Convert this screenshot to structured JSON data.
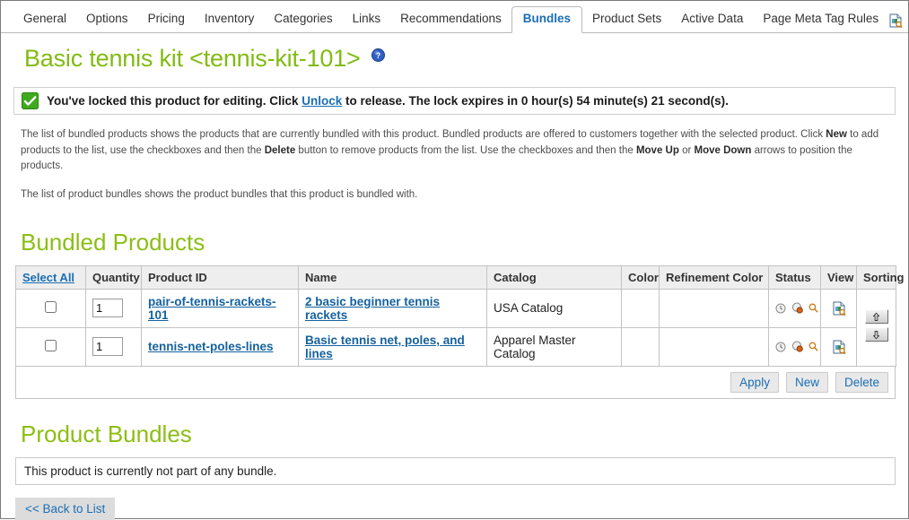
{
  "tabs": [
    {
      "label": "General",
      "active": false
    },
    {
      "label": "Options",
      "active": false
    },
    {
      "label": "Pricing",
      "active": false
    },
    {
      "label": "Inventory",
      "active": false
    },
    {
      "label": "Categories",
      "active": false
    },
    {
      "label": "Links",
      "active": false
    },
    {
      "label": "Recommendations",
      "active": false
    },
    {
      "label": "Bundles",
      "active": true
    },
    {
      "label": "Product Sets",
      "active": false
    },
    {
      "label": "Active Data",
      "active": false
    },
    {
      "label": "Page Meta Tag Rules",
      "active": false
    }
  ],
  "tabbar": {
    "end_icon": "document-search-icon"
  },
  "header": {
    "title": "Basic tennis kit <tennis-kit-101>",
    "help_icon": "help-circle-icon",
    "title_color": "#81bb13"
  },
  "lock_banner": {
    "icon": "green-check-badge-icon",
    "text_before": "You've locked this product for editing. Click ",
    "link_label": "Unlock",
    "text_after": " to release. The lock expires in 0 hour(s) 54 minute(s) 21 second(s).",
    "accent_color": "#3faa1e"
  },
  "intro": {
    "p1_parts": [
      {
        "t": "The list of bundled products shows the products that are currently bundled with this product. Bundled products are offered to customers together with the selected product. Click ",
        "b": false
      },
      {
        "t": "New",
        "b": true
      },
      {
        "t": " to add products to the list, use the checkboxes and then the ",
        "b": false
      },
      {
        "t": "Delete",
        "b": true
      },
      {
        "t": " button to remove products from the list. Use the checkboxes and then the ",
        "b": false
      },
      {
        "t": "Move Up",
        "b": true
      },
      {
        "t": " or ",
        "b": false
      },
      {
        "t": "Move Down",
        "b": true
      },
      {
        "t": " arrows to position the products.",
        "b": false
      }
    ],
    "p2": "The list of product bundles shows the product bundles that this product is bundled with."
  },
  "bundled_products": {
    "heading": "Bundled Products",
    "columns": [
      {
        "label": "Select All",
        "key": "select",
        "link": true
      },
      {
        "label": "Quantity",
        "key": "quantity"
      },
      {
        "label": "Product ID",
        "key": "product_id"
      },
      {
        "label": "Name",
        "key": "name"
      },
      {
        "label": "Catalog",
        "key": "catalog"
      },
      {
        "label": "Color",
        "key": "color"
      },
      {
        "label": "Refinement Color",
        "key": "refinement_color"
      },
      {
        "label": "Status",
        "key": "status"
      },
      {
        "label": "View",
        "key": "view"
      },
      {
        "label": "Sorting",
        "key": "sorting"
      }
    ],
    "rows": [
      {
        "checked": false,
        "quantity": "1",
        "product_id": "pair-of-tennis-rackets-101",
        "name": "2 basic beginner tennis rackets",
        "catalog": "USA Catalog",
        "color": "",
        "refinement_color": "",
        "status_icons": [
          "clock-icon",
          "palette-icon",
          "magnifier-icon"
        ],
        "view_icon": "document-search-icon"
      },
      {
        "checked": false,
        "quantity": "1",
        "product_id": "tennis-net-poles-lines",
        "name": "Basic tennis net, poles, and lines",
        "catalog": "Apparel Master Catalog",
        "color": "",
        "refinement_color": "",
        "status_icons": [
          "clock-icon",
          "palette-icon",
          "magnifier-icon"
        ],
        "view_icon": "document-search-icon"
      }
    ],
    "sorting": {
      "up_icon": "arrow-up-icon",
      "down_icon": "arrow-down-icon"
    },
    "buttons": [
      {
        "label": "Apply",
        "name": "apply-button"
      },
      {
        "label": "New",
        "name": "new-button"
      },
      {
        "label": "Delete",
        "name": "delete-button"
      }
    ]
  },
  "product_bundles": {
    "heading": "Product Bundles",
    "empty_message": "This product is currently not part of any bundle."
  },
  "footer": {
    "back_label": "<< Back to List"
  }
}
